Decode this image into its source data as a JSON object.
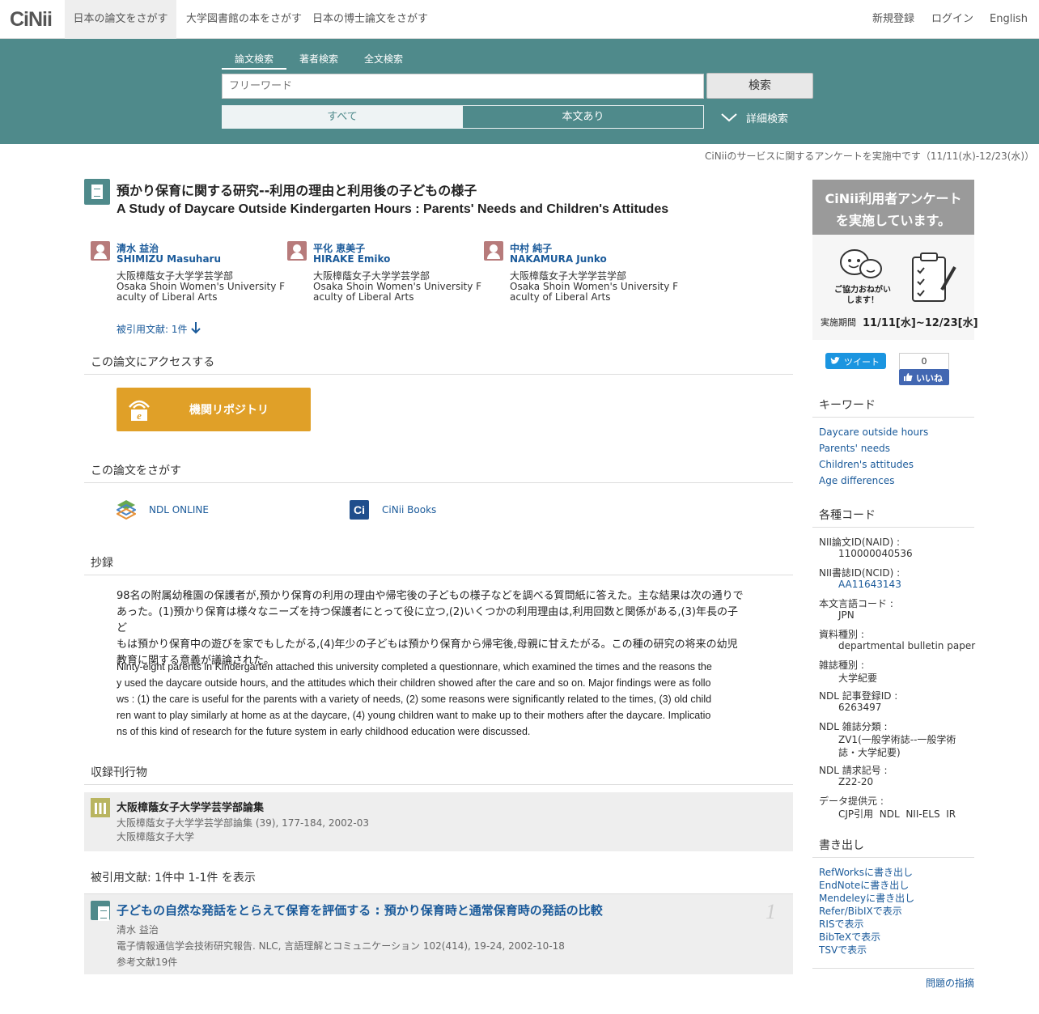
{
  "nav": {
    "logo": "CiNii",
    "tabs": [
      "日本の論文をさがす",
      "大学図書館の本をさがす",
      "日本の博士論文をさがす"
    ],
    "right": [
      "新規登録",
      "ログイン",
      "English"
    ]
  },
  "search": {
    "tabs": [
      "論文検索",
      "著者検索",
      "全文検索"
    ],
    "placeholder": "フリーワード",
    "button": "検索",
    "filters": [
      "すべて",
      "本文あり"
    ],
    "advanced": "詳細検索"
  },
  "notice": "CiNiiのサービスに関するアンケートを実施中です（11/11(水)-12/23(水)）",
  "article": {
    "title_ja": "預かり保育に関する研究--利用の理由と利用後の子どもの様子",
    "title_en": "A Study of Daycare Outside Kindergarten Hours : Parents' Needs and Children's Attitudes",
    "authors": [
      {
        "name_ja": "清水 益治",
        "name_en": "SHIMIZU Masuharu",
        "aff_ja": "大阪樟蔭女子大学学芸学部",
        "aff_en1": "Osaka Shoin Women's University F",
        "aff_en2": "aculty of Liberal Arts"
      },
      {
        "name_ja": "平化 恵美子",
        "name_en": "HIRAKE Emiko",
        "aff_ja": "大阪樟蔭女子大学学芸学部",
        "aff_en1": "Osaka Shoin Women's University F",
        "aff_en2": "aculty of Liberal Arts"
      },
      {
        "name_ja": "中村 純子",
        "name_en": "NAKAMURA Junko",
        "aff_ja": "大阪樟蔭女子大学学芸学部",
        "aff_en1": "Osaka Shoin Women's University F",
        "aff_en2": "aculty of Liberal Arts"
      }
    ],
    "cited_link": "被引用文献: 1件"
  },
  "access": {
    "title": "この論文にアクセスする",
    "repo_button": "機関リポジトリ"
  },
  "find": {
    "title": "この論文をさがす",
    "links": [
      "NDL ONLINE",
      "CiNii Books"
    ]
  },
  "abstract": {
    "title": "抄録",
    "ja_lines": [
      "98名の附属幼稚園の保護者が,預かり保育の利用の理由や帰宅後の子どもの様子などを調べる質問紙に答えた。主な結果は次の通りで",
      "あった。(1)預かり保育は様々なニーズを持つ保護者にとって役に立つ,(2)いくつかの利用理由は,利用回数と関係がある,(3)年長の子ど",
      "もは預かり保育中の遊びを家でもしたがる,(4)年少の子どもは預かり保育から帰宅後,母親に甘えたがる。この種の研究の将来の幼児",
      "教育に関する意義が議論された。"
    ],
    "en_lines": [
      "Ninty-eight parents in Kindergarten attached this university completed a questionnare, which examined the times and the reasons the",
      "y used the daycare outside hours, and the attitudes which their children showed after the care and so on. Major findings were as follo",
      "ws : (1) the care is useful for the parents with a variety of needs, (2) some reasons were significantly related to the times, (3) old child",
      "ren want to play similarly at home as at the daycare, (4) young children want to make up to their mothers after the daycare. Implicatio",
      "ns of this kind of research for the future system in early childhood education were discussed."
    ]
  },
  "journal": {
    "title": "収録刊行物",
    "name": "大阪樟蔭女子大学学芸学部論集",
    "detail": "大阪樟蔭女子大学学芸学部論集 (39), 177-184, 2002-03",
    "publisher": "大阪樟蔭女子大学"
  },
  "citations": {
    "title": "被引用文献:  1件中 1-1件 を表示",
    "items": [
      {
        "title": "子どもの自然な発話をとらえて保育を評価する : 預かり保育時と通常保育時の発話の比較",
        "author": "清水 益治",
        "source": "電子情報通信学会技術研究報告. NLC, 言語理解とコミュニケーション 102(414), 19-24, 2002-10-18",
        "refs": "参考文献19件",
        "num": "1"
      }
    ]
  },
  "sidebar": {
    "banner_line1": "CiNii利用者アンケート",
    "banner_line2": "を実施しています。",
    "banner_bubble": "ご協力おねがい\nします！",
    "banner_period_label": "実施期間",
    "banner_period": "11/11[水]~12/23[水]",
    "tweet": "ツイート",
    "like_count": "0",
    "like": "いいね",
    "keywords_title": "キーワード",
    "keywords": [
      "Daycare outside hours",
      "Parents' needs",
      "Children's attitudes",
      "Age differences"
    ],
    "codes_title": "各種コード",
    "codes": [
      {
        "label": "NII論文ID(NAID) :",
        "value": "110000040536"
      },
      {
        "label": "NII書誌ID(NCID) :",
        "value": "AA11643143"
      },
      {
        "label": "本文言語コード :",
        "value": "JPN"
      },
      {
        "label": "資料種別 :",
        "value": "departmental bulletin paper"
      },
      {
        "label": "雑誌種別 :",
        "value": "大学紀要"
      },
      {
        "label": "NDL 記事登録ID :",
        "value": "6263497"
      },
      {
        "label": "NDL 雑誌分類 :",
        "value": "ZV1(一般学術誌--一般学術",
        "value2": "誌・大学紀要)"
      },
      {
        "label": "NDL 請求記号 :",
        "value": "Z22-20"
      },
      {
        "label": "データ提供元 :",
        "value": "CJP引用  NDL  NII-ELS  IR"
      }
    ],
    "export_title": "書き出し",
    "exports": [
      "RefWorksに書き出し",
      "EndNoteに書き出し",
      "Mendeleyに書き出し",
      "Refer/BibIXで表示",
      "RISで表示",
      "BibTeXで表示",
      "TSVで表示"
    ],
    "report": "問題の指摘"
  }
}
